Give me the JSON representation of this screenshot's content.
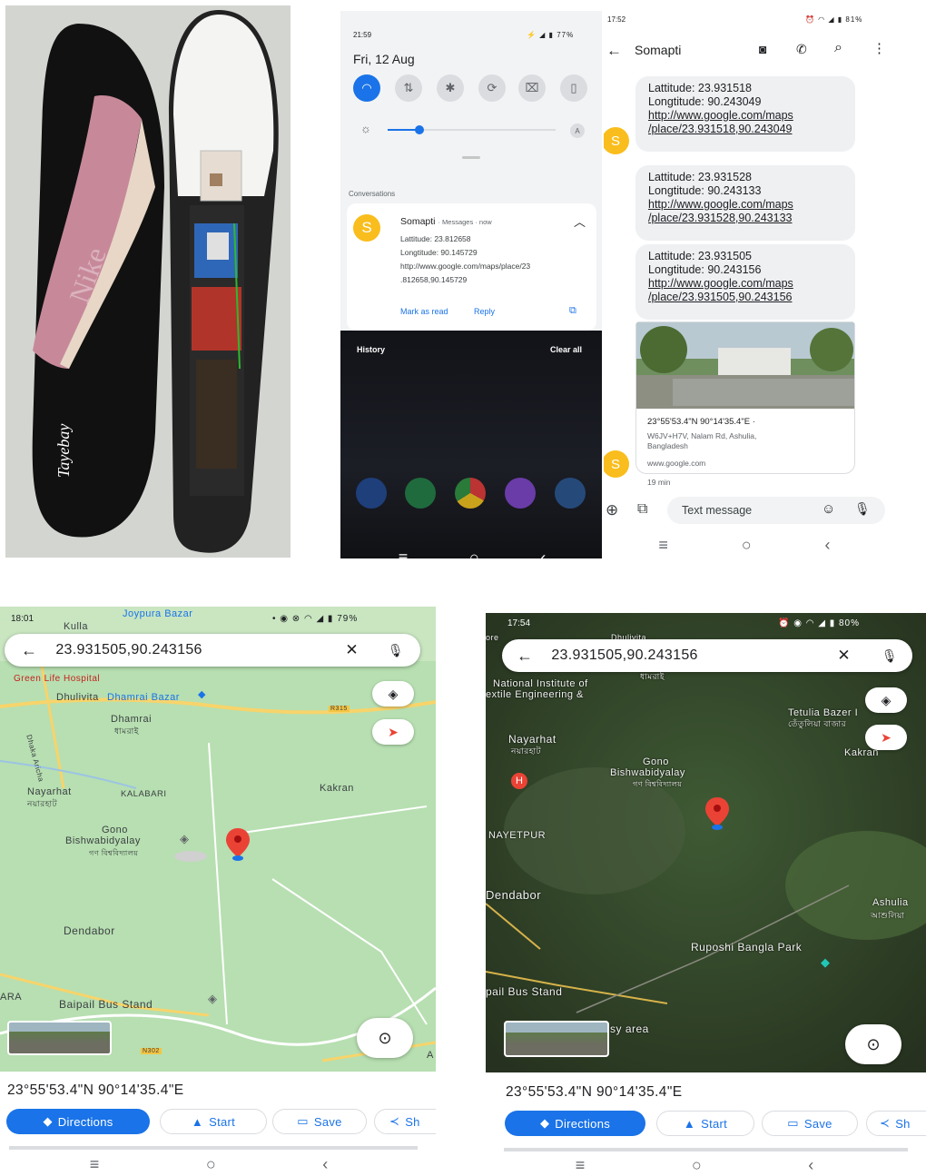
{
  "photo": {
    "brand": "Tayebay"
  },
  "shade": {
    "time": "21:59",
    "battery": "77%",
    "date": "Fri, 12 Aug",
    "brightness_auto": "A",
    "section": "Conversations",
    "notification": {
      "avatar": "S",
      "sender": "Somapti",
      "app": "Messages",
      "when": "now",
      "lines": [
        "Lattitude: 23.812658",
        "Longtitude: 90.145729",
        "http://www.google.com/maps/place/23",
        ".812658,90.145729"
      ],
      "mark_read": "Mark as read",
      "reply": "Reply"
    },
    "history": "History",
    "clear_all": "Clear all"
  },
  "messages": {
    "time": "17:52",
    "battery": "81%",
    "contact": "Somapti",
    "bubbles": [
      {
        "lat": "Lattitude: 23.931518",
        "lon": "Longtitude: 90.243049",
        "link1": "http://www.google.com/maps",
        "link2": "/place/23.931518,90.243049"
      },
      {
        "lat": "Lattitude: 23.931528",
        "lon": "Longtitude: 90.243133",
        "link1": "http://www.google.com/maps",
        "link2": "/place/23.931528,90.243133"
      },
      {
        "lat": "Lattitude: 23.931505",
        "lon": "Longtitude: 90.243156",
        "link1": "http://www.google.com/maps",
        "link2": "/place/23.931505,90.243156"
      }
    ],
    "avatar": "S",
    "card": {
      "coords": "23°55'53.4\"N 90°14'35.4\"E ·",
      "address1": "W6JV+H7V, Nalam Rd, Ashulia,",
      "address2": "Bangladesh",
      "domain": "www.google.com"
    },
    "age": "19 min",
    "compose_placeholder": "Text message"
  },
  "map1": {
    "time": "18:01",
    "battery": "79%",
    "query": "23.931505,90.243156",
    "coords": "23°55'53.4\"N 90°14'35.4\"E",
    "labels": {
      "kulla": "Kulla",
      "joypura": "Joypura Bazar",
      "green_life": "Green Life Hospital",
      "dhulivita": "Dhulivita",
      "dhamrai_bazar": "Dhamrai Bazar",
      "dhamrai": "Dhamrai",
      "dhamrai_bn": "ধামরাই",
      "road": "R315",
      "dhaka_aricha": "Dhaka Aricha",
      "kakran": "Kakran",
      "nayarhat": "Nayarhat",
      "nayarhat_bn": "নয়ারহাট",
      "kalabari": "KALABARI",
      "gono1": "Gono",
      "gono2": "Bishwabidyalay",
      "gono_bn": "গণ বিশ্ববিদ্যালয়",
      "dendabor": "Dendabor",
      "ara": "ARA",
      "baipail": "Baipail Bus Stand",
      "n302": "N302",
      "a": "A"
    },
    "chips": {
      "directions": "Directions",
      "start": "Start",
      "save": "Save",
      "share": "Sh"
    }
  },
  "map2": {
    "time": "17:54",
    "battery": "80%",
    "query": "23.931505,90.243156",
    "coords": "23°55'53.4\"N 90°14'35.4\"E",
    "labels": {
      "dhuli": "Dhulivita",
      "nat1": "National Institute of",
      "nat2": "extile Engineering &",
      "dhamrai_bn": "ধামরাই",
      "tetulia": "Tetulia Bazer I",
      "tetulia_bn": "তেঁতুলিয়া বাজার",
      "kakran": "Kakran",
      "nayarhat": "Nayarhat",
      "nayarhat_bn": "নয়ারহাট",
      "gono1": "Gono",
      "gono2": "Bishwabidyalay",
      "gono_bn": "গণ বিশ্ববিদ্যালয়",
      "nayetpur": "NAYETPUR",
      "dendabor": "Dendabor",
      "ashulia": "Ashulia",
      "ashulia_bn": "আশুলিয়া",
      "ruposhi": "Ruposhi Bangla Park",
      "baipail": "pail Bus Stand",
      "busy": "sy area",
      "ore": "ore"
    },
    "chips": {
      "directions": "Directions",
      "start": "Start",
      "save": "Save",
      "share": "Sh"
    }
  },
  "colors": {
    "accent": "#1a73e8",
    "avatar": "#f9bd1d",
    "pin": "#ea4335"
  }
}
